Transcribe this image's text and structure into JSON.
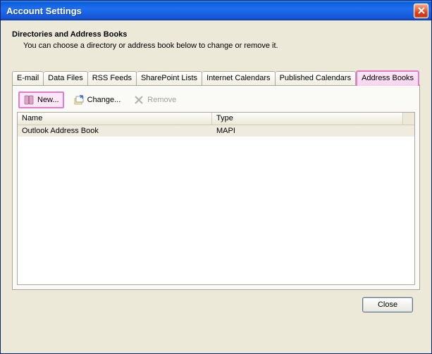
{
  "window": {
    "title": "Account Settings"
  },
  "header": {
    "heading": "Directories and Address Books",
    "subheading": "You can choose a directory or address book below to change or remove it."
  },
  "tabs": [
    {
      "label": "E-mail"
    },
    {
      "label": "Data Files"
    },
    {
      "label": "RSS Feeds"
    },
    {
      "label": "SharePoint Lists"
    },
    {
      "label": "Internet Calendars"
    },
    {
      "label": "Published Calendars"
    },
    {
      "label": "Address Books"
    }
  ],
  "toolbar": {
    "new_label": "New...",
    "change_label": "Change...",
    "remove_label": "Remove"
  },
  "list": {
    "col_name": "Name",
    "col_type": "Type",
    "rows": [
      {
        "name": "Outlook Address Book",
        "type": "MAPI"
      }
    ]
  },
  "footer": {
    "close_label": "Close"
  }
}
